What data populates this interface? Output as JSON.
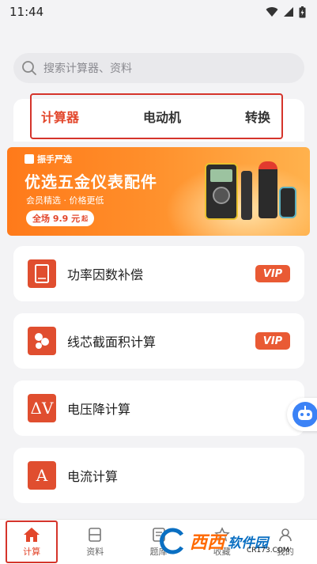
{
  "status_bar": {
    "time": "11:44"
  },
  "search": {
    "placeholder": "搜索计算器、资料"
  },
  "tabs": [
    {
      "label": "计算器",
      "active": true
    },
    {
      "label": "电动机",
      "active": false
    },
    {
      "label": "转换",
      "active": false
    }
  ],
  "banner": {
    "brand": "振手严选",
    "title": "优选五金仪表配件",
    "subtitle": "会员精选 · 价格更低",
    "pill": "全场 9.9 元",
    "pill_suffix": "起"
  },
  "calculators": [
    {
      "label": "功率因数补偿",
      "icon": "tablet-icon",
      "vip": "VIP"
    },
    {
      "label": "线芯截面积计算",
      "icon": "cable-core-icon",
      "vip": "VIP"
    },
    {
      "label": "电压降计算",
      "icon": "delta-v-icon",
      "icon_text": "ΔV"
    },
    {
      "label": "电流计算",
      "icon": "ampere-icon",
      "icon_text": "A"
    }
  ],
  "bottom_nav": [
    {
      "label": "计算",
      "icon": "home-icon",
      "active": true
    },
    {
      "label": "资料",
      "icon": "document-icon",
      "active": false
    },
    {
      "label": "题库",
      "icon": "question-bank-icon",
      "active": false
    },
    {
      "label": "收藏",
      "icon": "favorite-icon",
      "active": false
    },
    {
      "label": "我的",
      "icon": "profile-icon",
      "active": false
    }
  ],
  "watermark": {
    "text": "西西",
    "brand": "软件园",
    "url": "CR173.COM"
  },
  "colors": {
    "accent": "#e2462b",
    "icon_bg": "#e04e2f",
    "highlight": "#d5342b",
    "robot": "#3b82f6"
  }
}
